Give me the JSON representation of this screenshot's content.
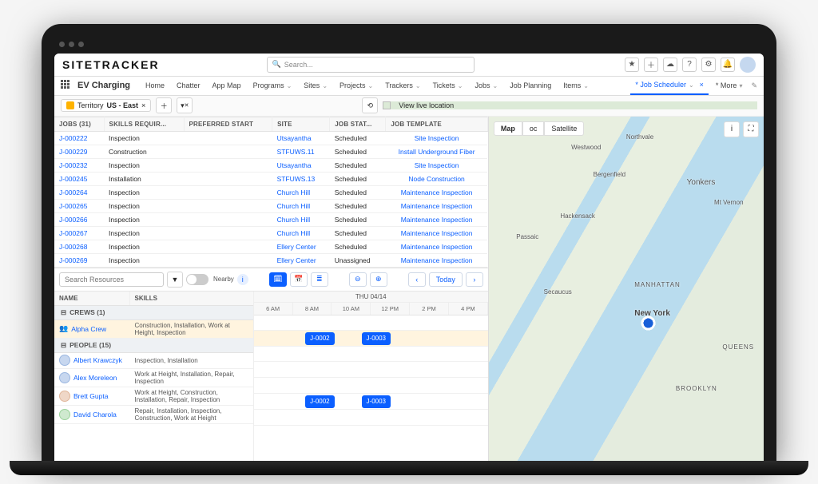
{
  "header": {
    "logo": "SITETRACKER",
    "search_placeholder": "Search...",
    "icons": {
      "star": "★",
      "plus": "＋",
      "clouds": "☁",
      "help": "?",
      "gear": "⚙",
      "bell": "🔔"
    }
  },
  "nav": {
    "app_title": "EV Charging",
    "items": [
      "Home",
      "Chatter",
      "App Map",
      "Programs",
      "Sites",
      "Projects",
      "Trackers",
      "Tickets",
      "Jobs",
      "Job Planning",
      "Items"
    ],
    "active_tab": "* Job Scheduler",
    "more": "* More"
  },
  "filter": {
    "territory_label": "Territory",
    "territory_value": "US - East",
    "view_live": "View live location"
  },
  "jobs": {
    "count_header": "JOBS (31)",
    "cols": [
      "SKILLS REQUIR...",
      "PREFERRED START",
      "SITE",
      "JOB STAT...",
      "JOB TEMPLATE"
    ],
    "rows": [
      {
        "id": "J-000222",
        "skill": "Inspection",
        "site": "Utsayantha",
        "status": "Scheduled",
        "template": "Site Inspection"
      },
      {
        "id": "J-000229",
        "skill": "Construction",
        "site": "STFUWS.11",
        "status": "Scheduled",
        "template": "Install Underground Fiber"
      },
      {
        "id": "J-000232",
        "skill": "Inspection",
        "site": "Utsayantha",
        "status": "Scheduled",
        "template": "Site Inspection"
      },
      {
        "id": "J-000245",
        "skill": "Installation",
        "site": "STFUWS.13",
        "status": "Scheduled",
        "template": "Node Construction"
      },
      {
        "id": "J-000264",
        "skill": "Inspection",
        "site": "Church Hill",
        "status": "Scheduled",
        "template": "Maintenance Inspection"
      },
      {
        "id": "J-000265",
        "skill": "Inspection",
        "site": "Church Hill",
        "status": "Scheduled",
        "template": "Maintenance Inspection"
      },
      {
        "id": "J-000266",
        "skill": "Inspection",
        "site": "Church Hill",
        "status": "Scheduled",
        "template": "Maintenance Inspection"
      },
      {
        "id": "J-000267",
        "skill": "Inspection",
        "site": "Church Hill",
        "status": "Scheduled",
        "template": "Maintenance Inspection"
      },
      {
        "id": "J-000268",
        "skill": "Inspection",
        "site": "Ellery Center",
        "status": "Scheduled",
        "template": "Maintenance Inspection"
      },
      {
        "id": "J-000269",
        "skill": "Inspection",
        "site": "Ellery Center",
        "status": "Unassigned",
        "template": "Maintenance Inspection"
      }
    ]
  },
  "resources": {
    "search_placeholder": "Search Resources",
    "nearby_label": "Nearby",
    "today_label": "Today",
    "date_header": "THU 04/14",
    "hours": [
      "6 AM",
      "8 AM",
      "10 AM",
      "12 PM",
      "2 PM",
      "4 PM"
    ],
    "col_name": "NAME",
    "col_skills": "SKILLS",
    "group_crews": "CREWS (1)",
    "group_people": "PEOPLE (15)",
    "crew": {
      "name": "Alpha Crew",
      "skills": "Construction, Installation, Work at Height, Inspection"
    },
    "people": [
      {
        "name": "Albert Krawczyk",
        "skills": "Inspection, Installation"
      },
      {
        "name": "Alex Moreleon",
        "skills": "Work at Height, Installation, Repair, Inspection"
      },
      {
        "name": "Brett Gupta",
        "skills": "Work at Height, Construction, Installation, Repair, Inspection"
      },
      {
        "name": "David Charola",
        "skills": "Repair, Installation, Inspection, Construction, Work at Height"
      }
    ],
    "cards": {
      "a": "J-0002",
      "b": "J-0003"
    }
  },
  "map": {
    "modes": [
      "Map",
      "oc",
      "Satellite"
    ],
    "city": "New York",
    "places": [
      "Yonkers",
      "BROOKLYN",
      "QUEENS",
      "MANHATTAN",
      "Bergenfield",
      "Secaucus",
      "Passaic",
      "Hackensack",
      "Mt Vernon",
      "Westwood",
      "Northvale"
    ]
  }
}
